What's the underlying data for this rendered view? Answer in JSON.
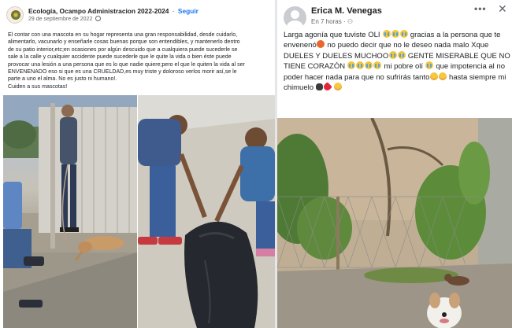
{
  "left_post": {
    "page_name": "Ecología, Ocampo Administracion 2022-2024",
    "separator": "·",
    "follow_label": "Seguir",
    "date": "29 de septiembre de 2022",
    "body": [
      "El contar con una mascota en su hogar representa una gran responsabilidad, desde cuidarlo,",
      "alimentarlo, vacunarlo y enseñarle cosas buenas porque son entendibles, y mantenerlo dentro",
      "de su patio interior,etc;en ocasiones por algún descuido que a cualquiera puede sucederle se",
      "sale a la calle y cualquier accidente puede sucederle  que le quite la vida o bien  éste puede",
      "provocar una lesión a una persona que es lo que nadie quiere;pero el que le quiten la vida al ser",
      "ENVENENADO eso si que es una CRUELDAD,es muy triste y doloroso verlos morir así,se le",
      "parte a uno el alma. No es justo ni humano!.",
      "Cuiden a sus mascotas!"
    ]
  },
  "right_post": {
    "author": "Erica M. Venegas",
    "time": "En 7 horas",
    "separator": "·",
    "more_icon": "•••",
    "close_icon": "✕",
    "text": {
      "t1": "Larga agonía que tuviste OLI ",
      "t2": " gracias a la persona que te envenenó",
      "t3": " no puedo decir que no le deseo nada malo Xque DUELES Y DUELES MUCHOO",
      "t4": "  GENTE MISERABLE QUE NO TIENE CORAZÓN ",
      "t5": "  mi pobre olí ",
      "t6": "  que impotencia al no poder hacer nada para que no sufrirás tanto",
      "t7": " hasta siempre mi chimuelo "
    }
  }
}
